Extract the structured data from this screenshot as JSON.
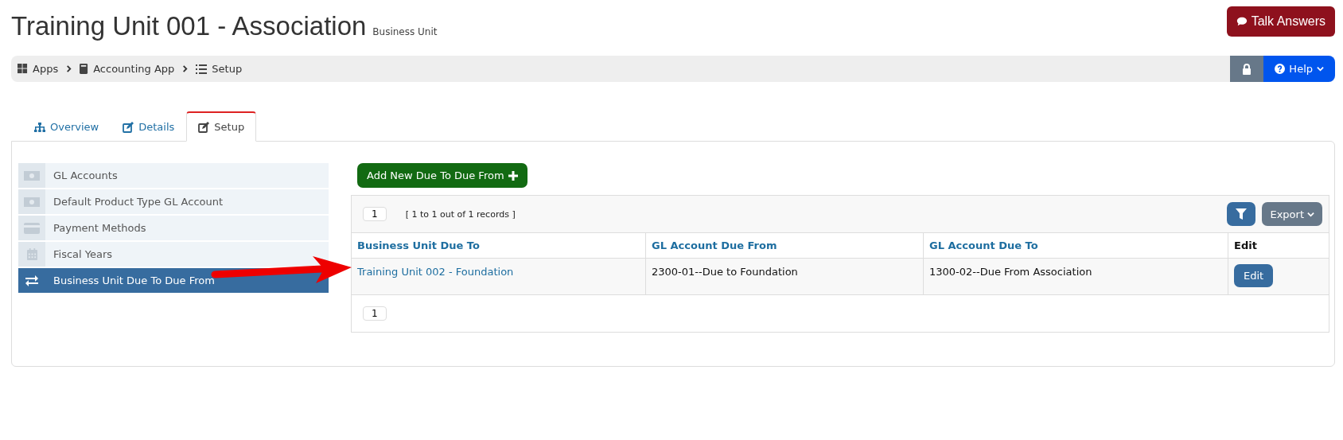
{
  "header": {
    "title": "Training Unit 001 - Association",
    "subtitle": "Business Unit",
    "talk_button": "Talk Answers"
  },
  "breadcrumb": [
    {
      "label": "Apps"
    },
    {
      "label": "Accounting App"
    },
    {
      "label": "Setup"
    }
  ],
  "help_button": "Help",
  "tabs": [
    {
      "label": "Overview",
      "selected": false
    },
    {
      "label": "Details",
      "selected": false
    },
    {
      "label": "Setup",
      "selected": true
    }
  ],
  "sidebar": {
    "items": [
      {
        "label": "GL Accounts",
        "selected": false
      },
      {
        "label": "Default Product Type GL Account",
        "selected": false
      },
      {
        "label": "Payment Methods",
        "selected": false
      },
      {
        "label": "Fiscal Years",
        "selected": false
      },
      {
        "label": "Business Unit Due To Due From",
        "selected": true
      }
    ]
  },
  "add_button": "Add New Due To Due From",
  "table": {
    "page": "1",
    "record_summary": "[ 1 to 1 out of 1 records ]",
    "export_button": "Export",
    "columns": [
      "Business Unit Due To",
      "GL Account Due From",
      "GL Account Due To",
      "Edit"
    ],
    "rows": [
      {
        "business_unit": "Training Unit 002 - Foundation",
        "due_from": "2300-01--Due to Foundation",
        "due_to": "1300-02--Due From Association",
        "edit": "Edit"
      }
    ],
    "footer_page": "1"
  }
}
